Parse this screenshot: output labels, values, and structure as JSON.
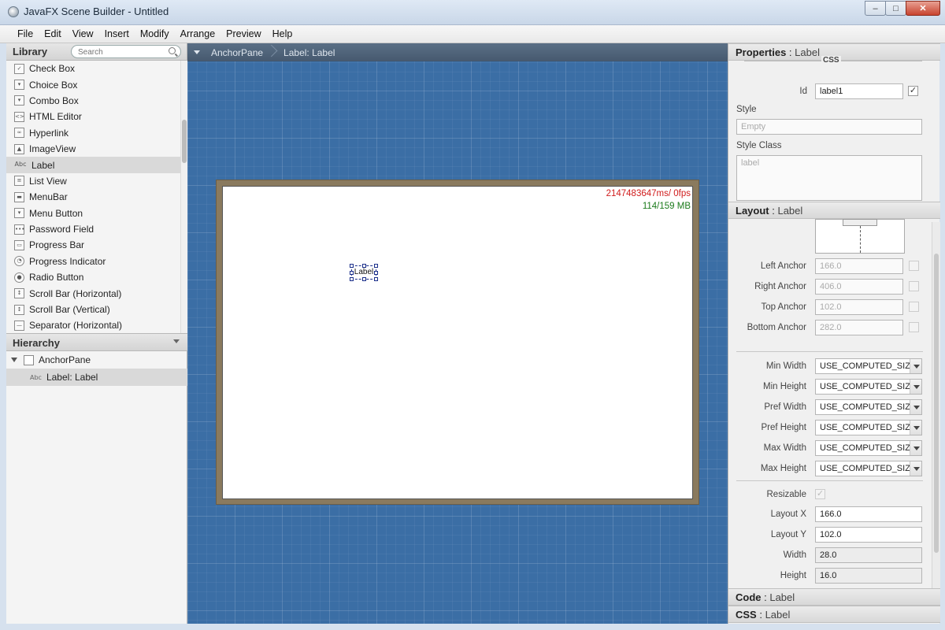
{
  "window": {
    "title": "JavaFX Scene Builder - Untitled",
    "buttons": [
      "–",
      "□",
      "✕"
    ]
  },
  "menu": [
    "File",
    "Edit",
    "View",
    "Insert",
    "Modify",
    "Arrange",
    "Preview",
    "Help"
  ],
  "library": {
    "title": "Library",
    "search_placeholder": "Search",
    "items": [
      {
        "label": "Check Box",
        "icon": "checkbox-icon"
      },
      {
        "label": "Choice Box",
        "icon": "choicebox-icon"
      },
      {
        "label": "Combo Box",
        "icon": "combobox-icon"
      },
      {
        "label": "HTML Editor",
        "icon": "html-editor-icon"
      },
      {
        "label": "Hyperlink",
        "icon": "hyperlink-icon"
      },
      {
        "label": "ImageView",
        "icon": "imageview-icon"
      },
      {
        "label": "Label",
        "icon": "label-icon"
      },
      {
        "label": "List View",
        "icon": "listview-icon"
      },
      {
        "label": "MenuBar",
        "icon": "menubar-icon"
      },
      {
        "label": "Menu Button",
        "icon": "menubutton-icon"
      },
      {
        "label": "Password Field",
        "icon": "password-field-icon"
      },
      {
        "label": "Progress Bar",
        "icon": "progress-bar-icon"
      },
      {
        "label": "Progress Indicator",
        "icon": "progress-indicator-icon"
      },
      {
        "label": "Radio Button",
        "icon": "radio-button-icon"
      },
      {
        "label": "Scroll Bar (Horizontal)",
        "icon": "scrollbar-h-icon"
      },
      {
        "label": "Scroll Bar (Vertical)",
        "icon": "scrollbar-v-icon"
      },
      {
        "label": "Separator (Horizontal)",
        "icon": "separator-h-icon"
      }
    ],
    "selected_index": 6
  },
  "hierarchy": {
    "title": "Hierarchy",
    "root": "AnchorPane",
    "child": "Label: Label",
    "child_abc": "Abc"
  },
  "breadcrumb": [
    "AnchorPane",
    "Label: Label"
  ],
  "canvas": {
    "fps": "2147483647ms/ 0fps",
    "mem": "114/159 MB",
    "label_text": "Label"
  },
  "properties": {
    "head_title": "Properties",
    "head_sub": "Label",
    "css_tag": "CSS",
    "id_label": "Id",
    "id_value": "label1",
    "style_label": "Style",
    "style_placeholder": "Empty",
    "styleclass_label": "Style Class",
    "styleclass_value": "label"
  },
  "layout": {
    "head_title": "Layout",
    "head_sub": "Label",
    "anchors": [
      {
        "label": "Left Anchor",
        "value": "166.0"
      },
      {
        "label": "Right Anchor",
        "value": "406.0"
      },
      {
        "label": "Top Anchor",
        "value": "102.0"
      },
      {
        "label": "Bottom Anchor",
        "value": "282.0"
      }
    ],
    "sizes": [
      {
        "label": "Min Width",
        "value": "USE_COMPUTED_SIZE"
      },
      {
        "label": "Min Height",
        "value": "USE_COMPUTED_SIZE"
      },
      {
        "label": "Pref Width",
        "value": "USE_COMPUTED_SIZE"
      },
      {
        "label": "Pref Height",
        "value": "USE_COMPUTED_SIZE"
      },
      {
        "label": "Max Width",
        "value": "USE_COMPUTED_SIZE"
      },
      {
        "label": "Max Height",
        "value": "USE_COMPUTED_SIZE"
      }
    ],
    "resizable_label": "Resizable",
    "layout_x_label": "Layout X",
    "layout_x": "166.0",
    "layout_y_label": "Layout Y",
    "layout_y": "102.0",
    "width_label": "Width",
    "width": "28.0",
    "height_label": "Height",
    "height": "16.0"
  },
  "code": {
    "head_title": "Code",
    "head_sub": "Label"
  },
  "css": {
    "head_title": "CSS",
    "head_sub": "Label"
  }
}
